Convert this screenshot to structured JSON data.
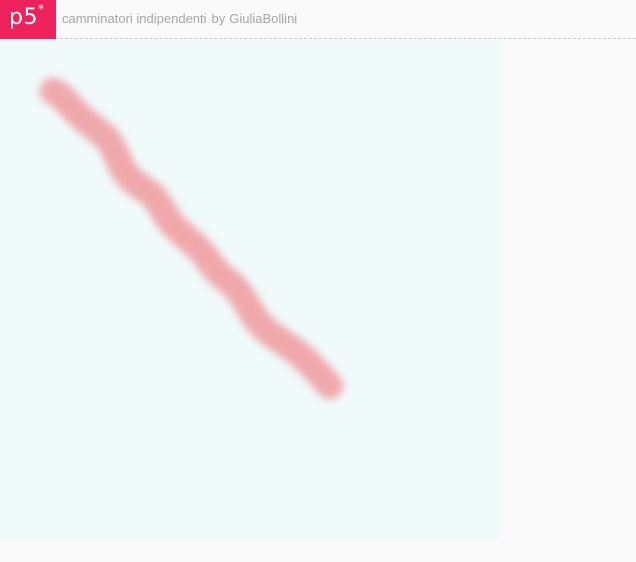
{
  "header": {
    "logo_text": "p5",
    "logo_asterisk": "*",
    "sketch_title": "camminatori indipendenti",
    "by_label": "by",
    "author": "GiuliaBollini"
  },
  "colors": {
    "brand": "#ed225d",
    "canvas_background": "#f0fafb",
    "page_background": "#fafafa",
    "stroke": "#f0a9ab",
    "header_text": "#a6a6a6"
  }
}
